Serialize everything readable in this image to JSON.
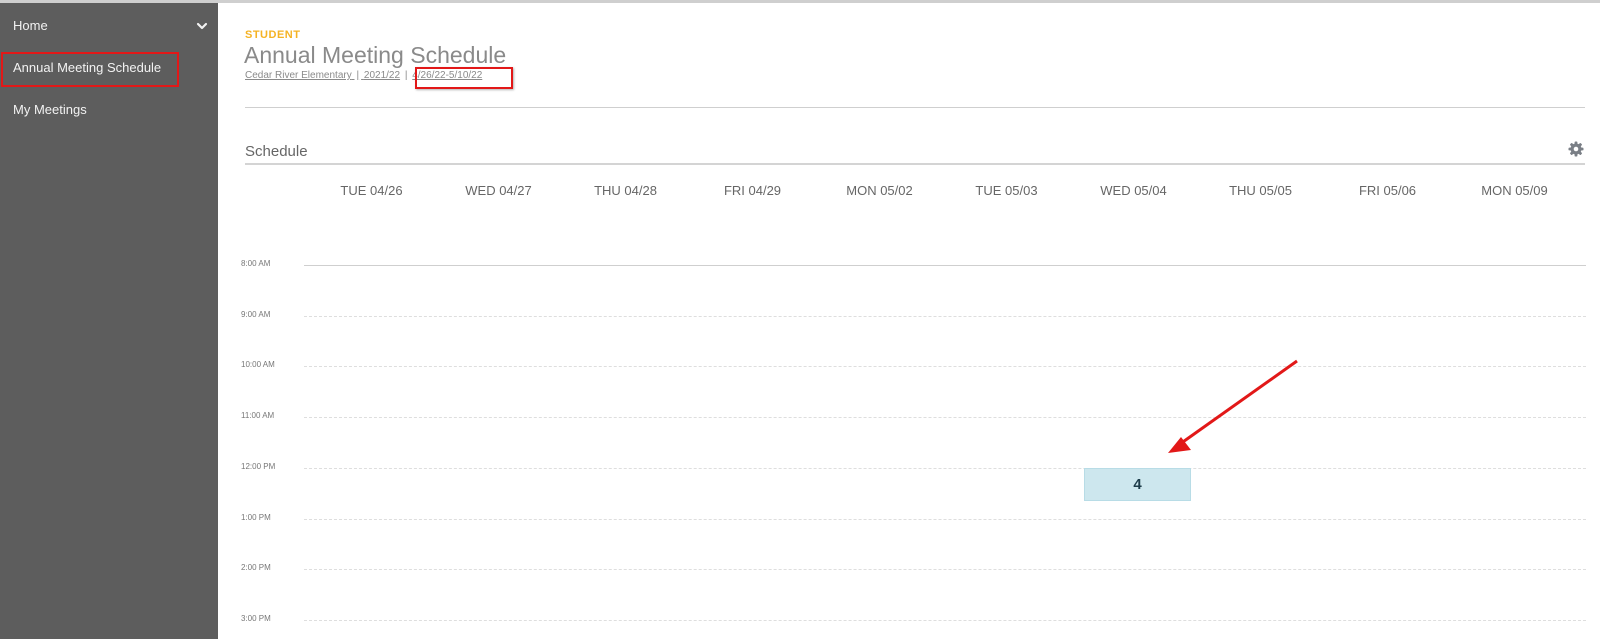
{
  "sidebar": {
    "items": [
      {
        "label": "Home"
      },
      {
        "label": "Annual Meeting Schedule"
      },
      {
        "label": "My Meetings"
      }
    ]
  },
  "header": {
    "eyebrow": "STUDENT",
    "title": "Annual Meeting Schedule",
    "breadcrumb": {
      "school": "Cedar River Elementary",
      "year": "2021/22",
      "range": "4/26/22-5/10/22",
      "separator": "|"
    }
  },
  "schedule": {
    "section_title": "Schedule",
    "days": [
      "TUE 04/26",
      "WED 04/27",
      "THU 04/28",
      "FRI 04/29",
      "MON 05/02",
      "TUE 05/03",
      "WED 05/04",
      "THU 05/05",
      "FRI 05/06",
      "MON 05/09"
    ],
    "times": [
      "8:00 AM",
      "9:00 AM",
      "10:00 AM",
      "11:00 AM",
      "12:00 PM",
      "1:00 PM",
      "2:00 PM",
      "3:00 PM"
    ],
    "event": {
      "label": "4",
      "day": "WED 05/04",
      "time": "12:00 PM"
    }
  },
  "colors": {
    "sidebar_bg": "#5d5d5d",
    "accent": "#f5b324",
    "event_bg": "#cde7ee",
    "highlight": "#e21818"
  },
  "icons": {
    "nav_chevron": "chevron-down-icon",
    "settings": "gear-icon",
    "annotation": "red-arrow"
  }
}
